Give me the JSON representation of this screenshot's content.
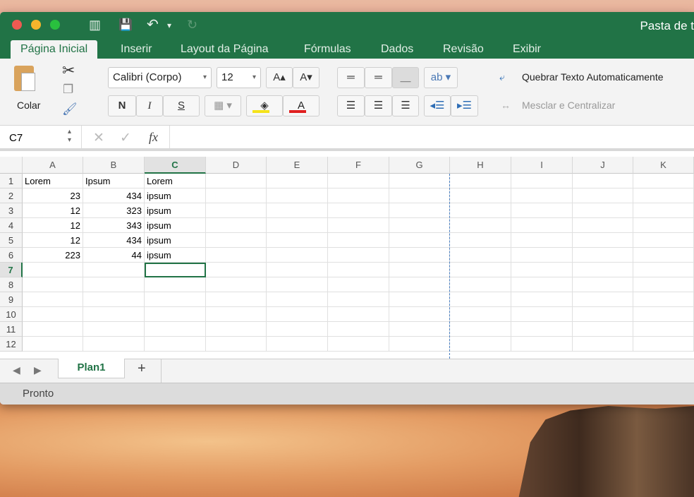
{
  "window": {
    "title": "Pasta de t"
  },
  "quick_access": {
    "sidebar": "▥",
    "save": "💾",
    "undo": "↶",
    "undo_menu": "▾",
    "redo": "↻"
  },
  "ribbon_tabs": [
    {
      "label": "Página Inicial",
      "active": true
    },
    {
      "label": "Inserir"
    },
    {
      "label": "Layout da Página"
    },
    {
      "label": "Fórmulas"
    },
    {
      "label": "Dados"
    },
    {
      "label": "Revisão"
    },
    {
      "label": "Exibir"
    }
  ],
  "ribbon": {
    "paste_label": "Colar",
    "font_name": "Calibri (Corpo)",
    "font_size": "12",
    "grow_font": "A▴",
    "shrink_font": "A▾",
    "bold": "N",
    "italic": "I",
    "underline": "S",
    "wrap_text": "Quebrar Texto Automaticamente",
    "merge_center": "Mesclar e Centralizar",
    "fill_color": "#f5e31a",
    "font_color": "#e02020"
  },
  "formula_bar": {
    "name_box": "C7",
    "fx": "fx",
    "value": ""
  },
  "columns": [
    "A",
    "B",
    "C",
    "D",
    "E",
    "F",
    "G",
    "H",
    "I",
    "J",
    "K"
  ],
  "selected_column": "C",
  "selected_row": "7",
  "rows": [
    {
      "n": "1",
      "cells": [
        "Lorem",
        "Ipsum",
        "Lorem"
      ]
    },
    {
      "n": "2",
      "cells": [
        "23",
        "434",
        "ipsum"
      ]
    },
    {
      "n": "3",
      "cells": [
        "12",
        "323",
        "ipsum"
      ]
    },
    {
      "n": "4",
      "cells": [
        "12",
        "343",
        "ipsum"
      ]
    },
    {
      "n": "5",
      "cells": [
        "12",
        "434",
        "ipsum"
      ]
    },
    {
      "n": "6",
      "cells": [
        "223",
        "44",
        "ipsum"
      ]
    },
    {
      "n": "7",
      "cells": [
        "",
        "",
        ""
      ]
    },
    {
      "n": "8",
      "cells": [
        "",
        "",
        ""
      ]
    },
    {
      "n": "9",
      "cells": [
        "",
        "",
        ""
      ]
    },
    {
      "n": "10",
      "cells": [
        "",
        "",
        ""
      ]
    },
    {
      "n": "11",
      "cells": [
        "",
        "",
        ""
      ]
    },
    {
      "n": "12",
      "cells": [
        "",
        "",
        ""
      ]
    }
  ],
  "sheet_tabs": [
    {
      "label": "Plan1",
      "active": true
    }
  ],
  "add_sheet": "+",
  "status": "Pronto",
  "accent": "#217346"
}
